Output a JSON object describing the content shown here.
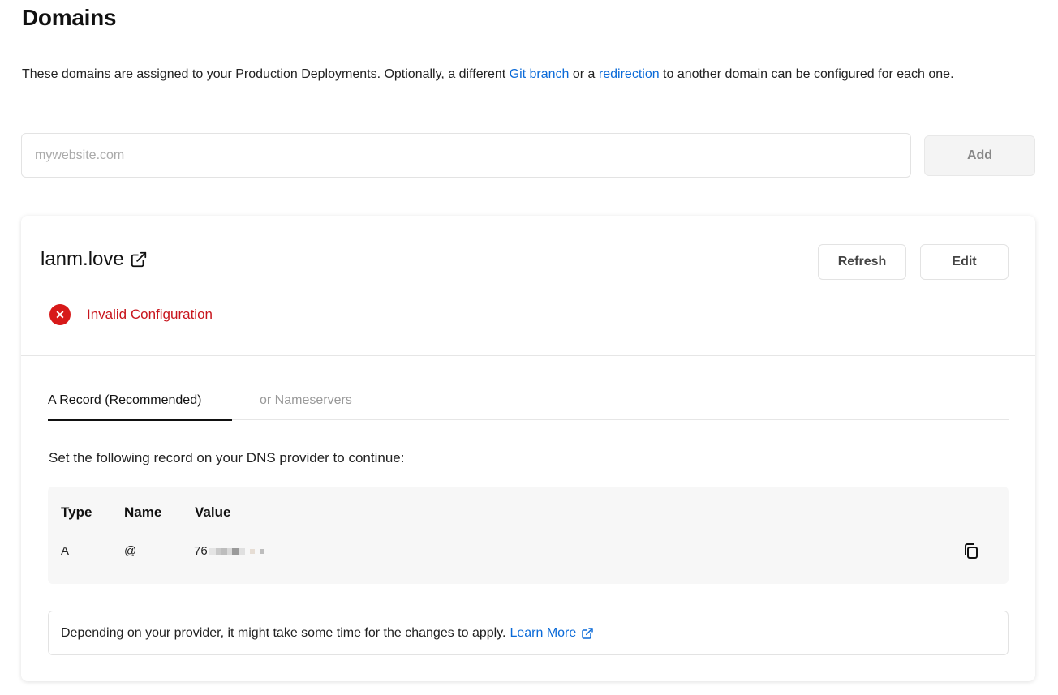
{
  "page": {
    "title": "Domains",
    "description_prefix": "These domains are assigned to your Production Deployments. Optionally, a different ",
    "link_git_branch": "Git branch",
    "description_mid": " or a ",
    "link_redirection": "redirection",
    "description_suffix": " to another domain can be configured for each one."
  },
  "add_form": {
    "placeholder": "mywebsite.com",
    "value": "",
    "add_label": "Add"
  },
  "domain_card": {
    "domain": "lanm.love",
    "refresh_label": "Refresh",
    "edit_label": "Edit",
    "status": "Invalid Configuration",
    "status_color": "#d71919",
    "tabs": [
      {
        "label": "A Record (Recommended)",
        "active": true
      },
      {
        "label": "or Nameservers",
        "active": false
      }
    ],
    "instruction": "Set the following record on your DNS provider to continue:",
    "record": {
      "headers": [
        "Type",
        "Name",
        "Value"
      ],
      "type": "A",
      "name": "@",
      "value_visible": "76"
    },
    "note_text": "Depending on your provider, it might take some time for the changes to apply.",
    "learn_more_label": "Learn More"
  },
  "colors": {
    "link": "#0a6ad8",
    "error_text": "#c8151d"
  },
  "icons": {
    "external_link": "external-link-icon",
    "error": "x-circle-icon",
    "copy": "copy-icon"
  }
}
